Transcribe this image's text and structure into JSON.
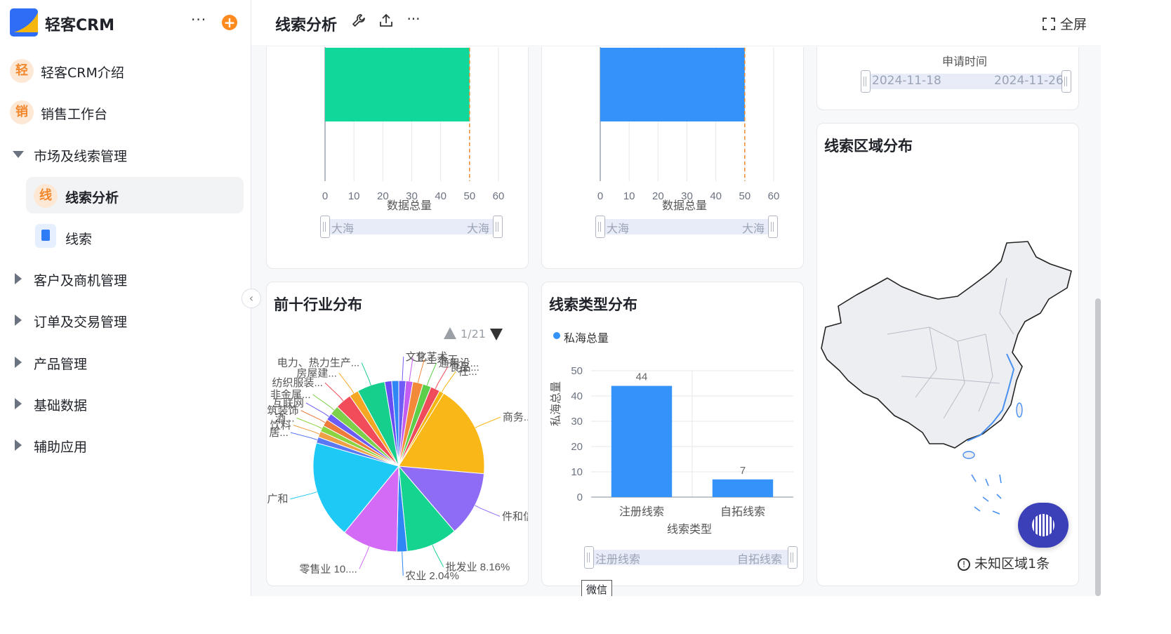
{
  "sidebar": {
    "app_title": "轻客CRM",
    "more_label": "···",
    "add_label": "+",
    "items": [
      {
        "badge": "轻",
        "label": "轻客CRM介绍"
      },
      {
        "badge": "销",
        "label": "销售工作台"
      },
      {
        "label": "市场及线索管理"
      },
      {
        "badge": "线",
        "label": "线索分析"
      },
      {
        "label": "线索"
      },
      {
        "label": "客户及商机管理"
      },
      {
        "label": "订单及交易管理"
      },
      {
        "label": "产品管理"
      },
      {
        "label": "基础数据"
      },
      {
        "label": "辅助应用"
      }
    ],
    "collapse_label": "‹"
  },
  "header": {
    "title": "线索分析",
    "more_label": "···",
    "fullscreen_label": "全屏"
  },
  "card_top_left": {
    "x_ticks": [
      "0",
      "10",
      "20",
      "30",
      "40",
      "50",
      "60"
    ],
    "xlabel": "数据总量",
    "slider_start": "大海",
    "slider_end": "大海"
  },
  "card_top_mid": {
    "x_ticks": [
      "0",
      "10",
      "20",
      "30",
      "40",
      "50",
      "60"
    ],
    "xlabel": "数据总量",
    "slider_start": "大海",
    "slider_end": "大海"
  },
  "card_top_right": {
    "axis_title": "申请时间",
    "date_start": "2024-11-18",
    "date_end": "2024-11-26"
  },
  "industry_card": {
    "title": "前十行业分布",
    "pager": "1/21"
  },
  "leadtype_card": {
    "title": "线索类型分布",
    "slider_start": "注册线索",
    "slider_end": "自拓线索"
  },
  "region_card": {
    "title": "线索区域分布",
    "unknown": "未知区域1条"
  },
  "tooltip": "微信",
  "chart_data": [
    {
      "type": "bar",
      "orientation": "horizontal",
      "xlabel": "数据总量",
      "xlim": [
        0,
        60
      ],
      "series": [
        {
          "values": [
            50
          ]
        }
      ],
      "color": "#0fd89a"
    },
    {
      "type": "bar",
      "orientation": "horizontal",
      "xlabel": "数据总量",
      "xlim": [
        0,
        60
      ],
      "series": [
        {
          "values": [
            50
          ]
        }
      ],
      "color": "#3592f9"
    },
    {
      "type": "pie",
      "title": "前十行业分布",
      "slices": [
        {
          "label": "文化艺术...",
          "value": 1.5,
          "color": "#6f5cf6"
        },
        {
          "label": "卫...",
          "value": 1.5,
          "color": "#c35cf0"
        },
        {
          "label": "土木工...",
          "value": 2.2,
          "color": "#f28a3a"
        },
        {
          "label": "通用设...",
          "value": 1.8,
          "color": "#5ccf4a"
        },
        {
          "label": "食品...",
          "value": 2.0,
          "color": "#ef4b5a"
        },
        {
          "label": "社...",
          "value": 1.0,
          "color": "#f5b60d"
        },
        {
          "label": "商务...",
          "value": 20.0,
          "color": "#f9b817"
        },
        {
          "label": "件和信息技...",
          "value": 14.0,
          "color": "#8e6cf6"
        },
        {
          "label": "批发业 8.16%",
          "value": 11.0,
          "color": "#14d48f"
        },
        {
          "label": "农业 2.04%",
          "value": 2.2,
          "color": "#2f87f6"
        },
        {
          "label": "零售业 10....",
          "value": 12.0,
          "color": "#d36bf6"
        },
        {
          "label": "科技推广和",
          "value": 21.0,
          "color": "#1ec9f5"
        },
        {
          "label": "居...",
          "value": 1.3,
          "color": "#5a78f4"
        },
        {
          "label": "饮料",
          "value": 1.3,
          "color": "#f0a044"
        },
        {
          "label": "酒...",
          "value": 1.3,
          "color": "#8bd33f"
        },
        {
          "label": "建筑装饰",
          "value": 1.5,
          "color": "#f07a3a"
        },
        {
          "label": "互联网",
          "value": 1.5,
          "color": "#6a5cf5"
        },
        {
          "label": "非金属...",
          "value": 2.0,
          "color": "#7cd04a"
        },
        {
          "label": "纺织服装...",
          "value": 3.5,
          "color": "#f24b5a"
        },
        {
          "label": "房屋建...",
          "value": 2.0,
          "color": "#f5a623"
        },
        {
          "label": "电力、热力生产...",
          "value": 6.0,
          "color": "#16cf8c"
        },
        {
          "label": "",
          "value": 1.5,
          "color": "#6a4cf5"
        },
        {
          "label": "",
          "value": 1.5,
          "color": "#2f87f6"
        }
      ]
    },
    {
      "type": "bar",
      "title": "线索类型分布",
      "legend": "私海总量",
      "categories": [
        "注册线索",
        "自拓线索"
      ],
      "values": [
        44,
        7
      ],
      "xlabel": "线索类型",
      "ylabel": "私海总量",
      "ylim": [
        0,
        50
      ],
      "y_ticks": [
        0,
        10,
        20,
        30,
        40,
        50
      ],
      "color": "#3592f9"
    }
  ]
}
